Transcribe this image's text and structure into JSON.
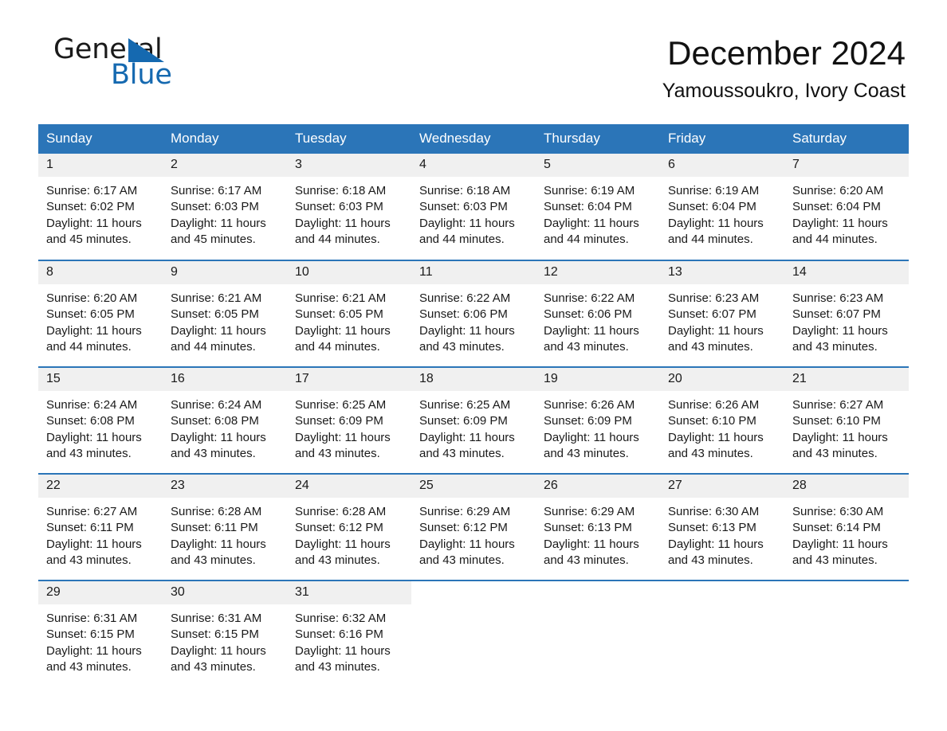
{
  "brand": {
    "name_part1": "General",
    "name_part2": "Blue",
    "flag_icon": "blue-triangle-flag-icon",
    "flag_color": "#1569b0"
  },
  "header": {
    "month_title": "December 2024",
    "location": "Yamoussoukro, Ivory Coast"
  },
  "colors": {
    "header_blue": "#2b75b8",
    "row_divider_blue": "#2b75b8",
    "daynum_band": "#f0f0f0",
    "text": "#1a1a1a"
  },
  "weekdays": [
    "Sunday",
    "Monday",
    "Tuesday",
    "Wednesday",
    "Thursday",
    "Friday",
    "Saturday"
  ],
  "weeks": [
    [
      {
        "day": "1",
        "sunrise": "Sunrise: 6:17 AM",
        "sunset": "Sunset: 6:02 PM",
        "daylight_line1": "Daylight: 11 hours",
        "daylight_line2": "and 45 minutes."
      },
      {
        "day": "2",
        "sunrise": "Sunrise: 6:17 AM",
        "sunset": "Sunset: 6:03 PM",
        "daylight_line1": "Daylight: 11 hours",
        "daylight_line2": "and 45 minutes."
      },
      {
        "day": "3",
        "sunrise": "Sunrise: 6:18 AM",
        "sunset": "Sunset: 6:03 PM",
        "daylight_line1": "Daylight: 11 hours",
        "daylight_line2": "and 44 minutes."
      },
      {
        "day": "4",
        "sunrise": "Sunrise: 6:18 AM",
        "sunset": "Sunset: 6:03 PM",
        "daylight_line1": "Daylight: 11 hours",
        "daylight_line2": "and 44 minutes."
      },
      {
        "day": "5",
        "sunrise": "Sunrise: 6:19 AM",
        "sunset": "Sunset: 6:04 PM",
        "daylight_line1": "Daylight: 11 hours",
        "daylight_line2": "and 44 minutes."
      },
      {
        "day": "6",
        "sunrise": "Sunrise: 6:19 AM",
        "sunset": "Sunset: 6:04 PM",
        "daylight_line1": "Daylight: 11 hours",
        "daylight_line2": "and 44 minutes."
      },
      {
        "day": "7",
        "sunrise": "Sunrise: 6:20 AM",
        "sunset": "Sunset: 6:04 PM",
        "daylight_line1": "Daylight: 11 hours",
        "daylight_line2": "and 44 minutes."
      }
    ],
    [
      {
        "day": "8",
        "sunrise": "Sunrise: 6:20 AM",
        "sunset": "Sunset: 6:05 PM",
        "daylight_line1": "Daylight: 11 hours",
        "daylight_line2": "and 44 minutes."
      },
      {
        "day": "9",
        "sunrise": "Sunrise: 6:21 AM",
        "sunset": "Sunset: 6:05 PM",
        "daylight_line1": "Daylight: 11 hours",
        "daylight_line2": "and 44 minutes."
      },
      {
        "day": "10",
        "sunrise": "Sunrise: 6:21 AM",
        "sunset": "Sunset: 6:05 PM",
        "daylight_line1": "Daylight: 11 hours",
        "daylight_line2": "and 44 minutes."
      },
      {
        "day": "11",
        "sunrise": "Sunrise: 6:22 AM",
        "sunset": "Sunset: 6:06 PM",
        "daylight_line1": "Daylight: 11 hours",
        "daylight_line2": "and 43 minutes."
      },
      {
        "day": "12",
        "sunrise": "Sunrise: 6:22 AM",
        "sunset": "Sunset: 6:06 PM",
        "daylight_line1": "Daylight: 11 hours",
        "daylight_line2": "and 43 minutes."
      },
      {
        "day": "13",
        "sunrise": "Sunrise: 6:23 AM",
        "sunset": "Sunset: 6:07 PM",
        "daylight_line1": "Daylight: 11 hours",
        "daylight_line2": "and 43 minutes."
      },
      {
        "day": "14",
        "sunrise": "Sunrise: 6:23 AM",
        "sunset": "Sunset: 6:07 PM",
        "daylight_line1": "Daylight: 11 hours",
        "daylight_line2": "and 43 minutes."
      }
    ],
    [
      {
        "day": "15",
        "sunrise": "Sunrise: 6:24 AM",
        "sunset": "Sunset: 6:08 PM",
        "daylight_line1": "Daylight: 11 hours",
        "daylight_line2": "and 43 minutes."
      },
      {
        "day": "16",
        "sunrise": "Sunrise: 6:24 AM",
        "sunset": "Sunset: 6:08 PM",
        "daylight_line1": "Daylight: 11 hours",
        "daylight_line2": "and 43 minutes."
      },
      {
        "day": "17",
        "sunrise": "Sunrise: 6:25 AM",
        "sunset": "Sunset: 6:09 PM",
        "daylight_line1": "Daylight: 11 hours",
        "daylight_line2": "and 43 minutes."
      },
      {
        "day": "18",
        "sunrise": "Sunrise: 6:25 AM",
        "sunset": "Sunset: 6:09 PM",
        "daylight_line1": "Daylight: 11 hours",
        "daylight_line2": "and 43 minutes."
      },
      {
        "day": "19",
        "sunrise": "Sunrise: 6:26 AM",
        "sunset": "Sunset: 6:09 PM",
        "daylight_line1": "Daylight: 11 hours",
        "daylight_line2": "and 43 minutes."
      },
      {
        "day": "20",
        "sunrise": "Sunrise: 6:26 AM",
        "sunset": "Sunset: 6:10 PM",
        "daylight_line1": "Daylight: 11 hours",
        "daylight_line2": "and 43 minutes."
      },
      {
        "day": "21",
        "sunrise": "Sunrise: 6:27 AM",
        "sunset": "Sunset: 6:10 PM",
        "daylight_line1": "Daylight: 11 hours",
        "daylight_line2": "and 43 minutes."
      }
    ],
    [
      {
        "day": "22",
        "sunrise": "Sunrise: 6:27 AM",
        "sunset": "Sunset: 6:11 PM",
        "daylight_line1": "Daylight: 11 hours",
        "daylight_line2": "and 43 minutes."
      },
      {
        "day": "23",
        "sunrise": "Sunrise: 6:28 AM",
        "sunset": "Sunset: 6:11 PM",
        "daylight_line1": "Daylight: 11 hours",
        "daylight_line2": "and 43 minutes."
      },
      {
        "day": "24",
        "sunrise": "Sunrise: 6:28 AM",
        "sunset": "Sunset: 6:12 PM",
        "daylight_line1": "Daylight: 11 hours",
        "daylight_line2": "and 43 minutes."
      },
      {
        "day": "25",
        "sunrise": "Sunrise: 6:29 AM",
        "sunset": "Sunset: 6:12 PM",
        "daylight_line1": "Daylight: 11 hours",
        "daylight_line2": "and 43 minutes."
      },
      {
        "day": "26",
        "sunrise": "Sunrise: 6:29 AM",
        "sunset": "Sunset: 6:13 PM",
        "daylight_line1": "Daylight: 11 hours",
        "daylight_line2": "and 43 minutes."
      },
      {
        "day": "27",
        "sunrise": "Sunrise: 6:30 AM",
        "sunset": "Sunset: 6:13 PM",
        "daylight_line1": "Daylight: 11 hours",
        "daylight_line2": "and 43 minutes."
      },
      {
        "day": "28",
        "sunrise": "Sunrise: 6:30 AM",
        "sunset": "Sunset: 6:14 PM",
        "daylight_line1": "Daylight: 11 hours",
        "daylight_line2": "and 43 minutes."
      }
    ],
    [
      {
        "day": "29",
        "sunrise": "Sunrise: 6:31 AM",
        "sunset": "Sunset: 6:15 PM",
        "daylight_line1": "Daylight: 11 hours",
        "daylight_line2": "and 43 minutes."
      },
      {
        "day": "30",
        "sunrise": "Sunrise: 6:31 AM",
        "sunset": "Sunset: 6:15 PM",
        "daylight_line1": "Daylight: 11 hours",
        "daylight_line2": "and 43 minutes."
      },
      {
        "day": "31",
        "sunrise": "Sunrise: 6:32 AM",
        "sunset": "Sunset: 6:16 PM",
        "daylight_line1": "Daylight: 11 hours",
        "daylight_line2": "and 43 minutes."
      },
      {
        "day": "",
        "sunrise": "",
        "sunset": "",
        "daylight_line1": "",
        "daylight_line2": "",
        "blank": true
      },
      {
        "day": "",
        "sunrise": "",
        "sunset": "",
        "daylight_line1": "",
        "daylight_line2": "",
        "blank": true
      },
      {
        "day": "",
        "sunrise": "",
        "sunset": "",
        "daylight_line1": "",
        "daylight_line2": "",
        "blank": true
      },
      {
        "day": "",
        "sunrise": "",
        "sunset": "",
        "daylight_line1": "",
        "daylight_line2": "",
        "blank": true
      }
    ]
  ]
}
